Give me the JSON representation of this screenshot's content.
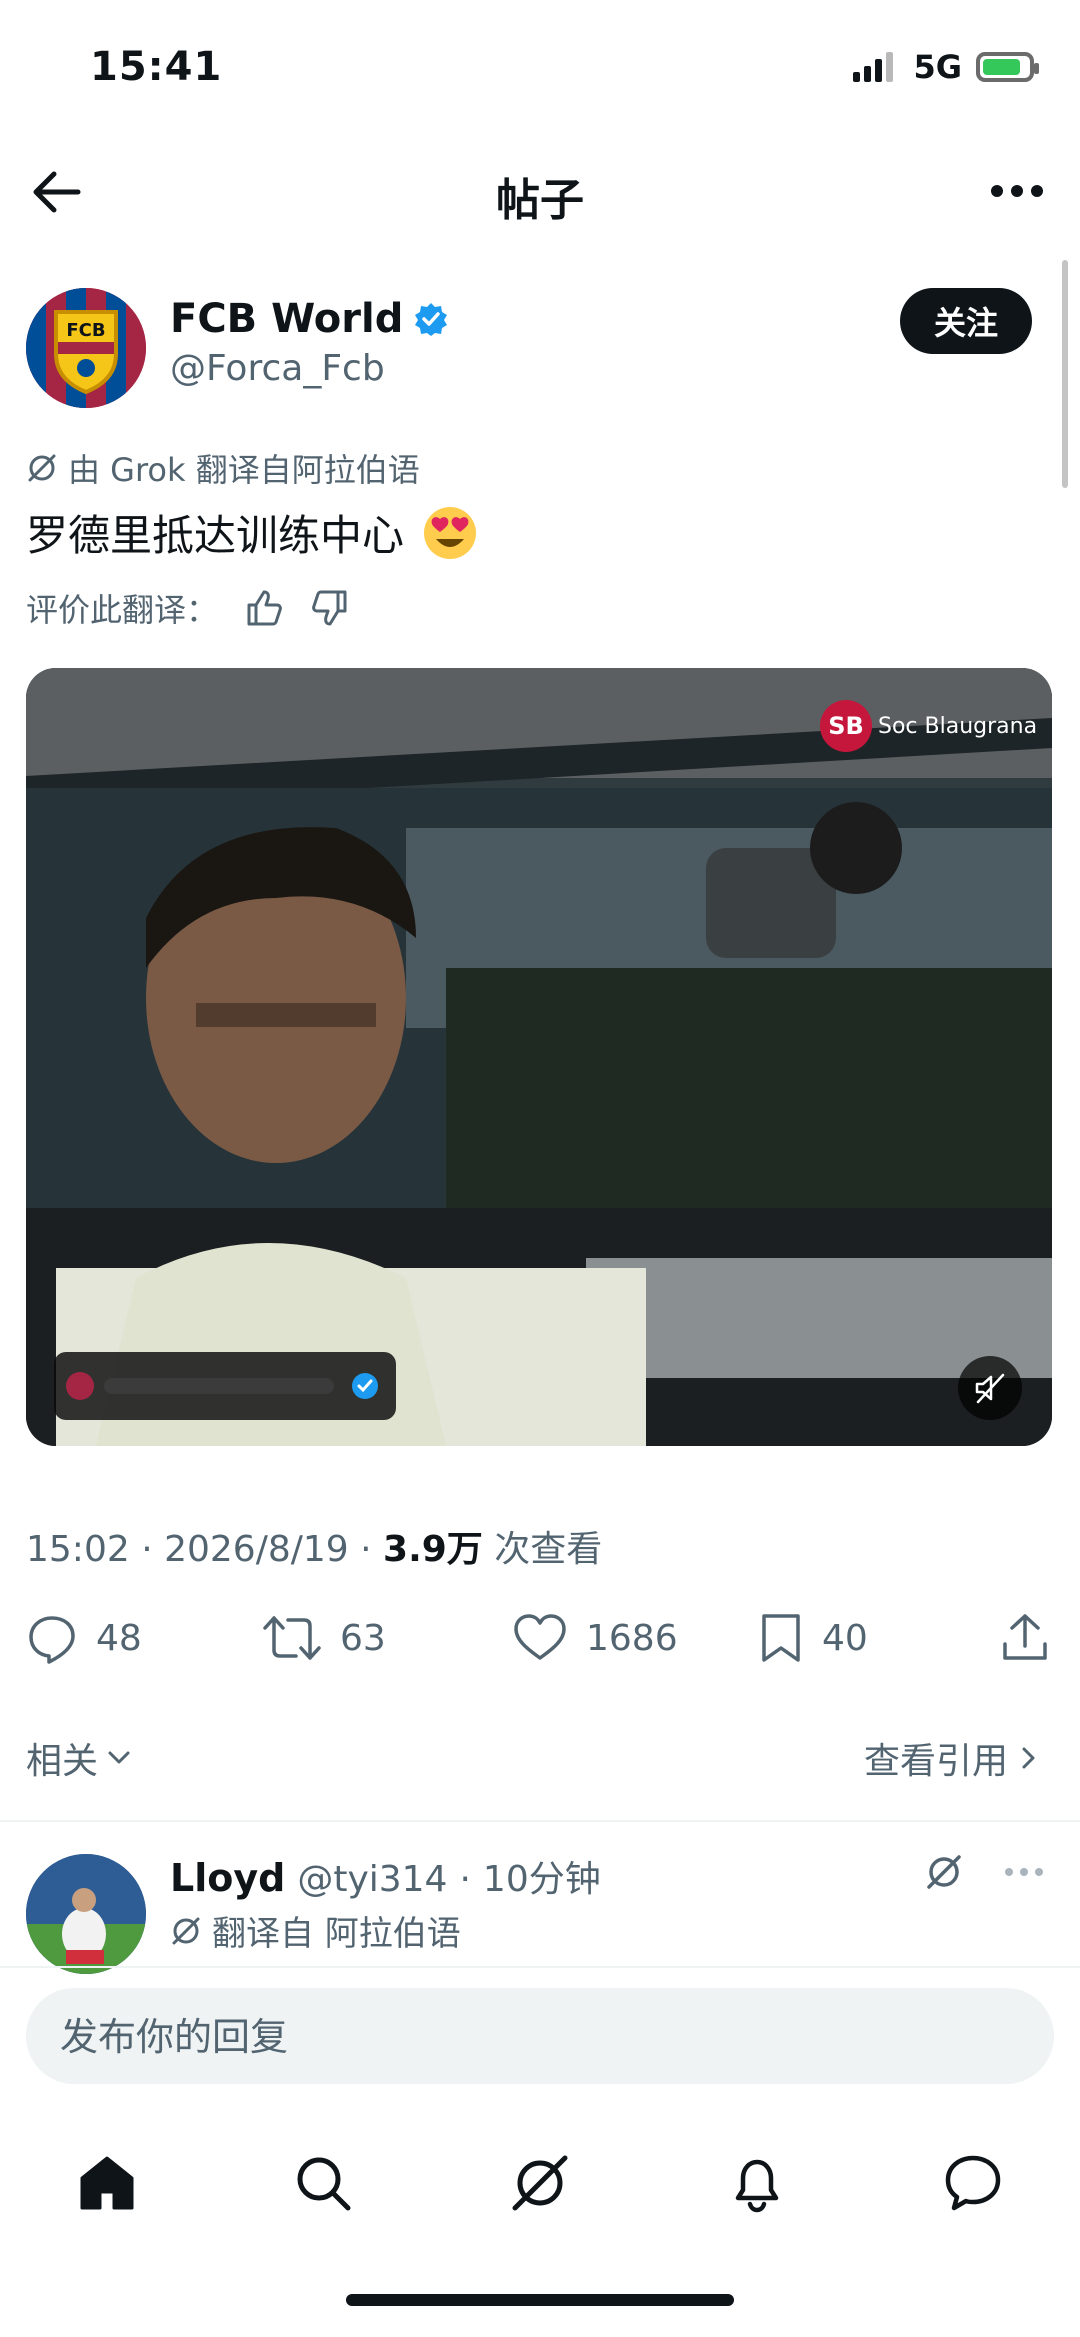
{
  "status_bar": {
    "time": "15:41",
    "network": "5G",
    "battery_percent": 85
  },
  "header": {
    "title": "帖子"
  },
  "post": {
    "author_name": "FCB World",
    "handle": "@Forca_Fcb",
    "follow_label": "关注",
    "avatar_text": "FCB",
    "translation_note": "由 Grok 翻译自阿拉伯语",
    "text": "罗德里抵达训练中心",
    "emoji": "😍",
    "rate_label": "评价此翻译：",
    "media": {
      "watermark_text": "Soc Blaugrana",
      "watermark_logo": "SB"
    },
    "meta": {
      "time": "15:02",
      "date": "2026/8/19",
      "views": "3.9万",
      "views_label": "次查看"
    },
    "stats": {
      "replies": "48",
      "reposts": "63",
      "likes": "1686",
      "bookmarks": "40"
    }
  },
  "related_label": "相关",
  "quotes_label": "查看引用",
  "reply": {
    "author_name": "Lloyd",
    "handle": "@tyi314",
    "time": "10分钟",
    "translation_note": "翻译自 阿拉伯语"
  },
  "composer": {
    "placeholder": "发布你的回复"
  },
  "icons": [
    "back-arrow-icon",
    "more-icon",
    "verified-badge-icon",
    "grok-icon",
    "thumbs-up-icon",
    "thumbs-down-icon",
    "mute-icon",
    "reply-icon",
    "repost-icon",
    "like-icon",
    "bookmark-icon",
    "share-icon",
    "chevron-down-icon",
    "chevron-right-icon",
    "home-icon",
    "search-icon",
    "grok-tab-icon",
    "bell-icon",
    "messages-icon"
  ],
  "colors": {
    "accent": "#1d9bf0",
    "text": "#0f1419",
    "secondary": "#536471",
    "follow_bg": "#0f1419"
  }
}
